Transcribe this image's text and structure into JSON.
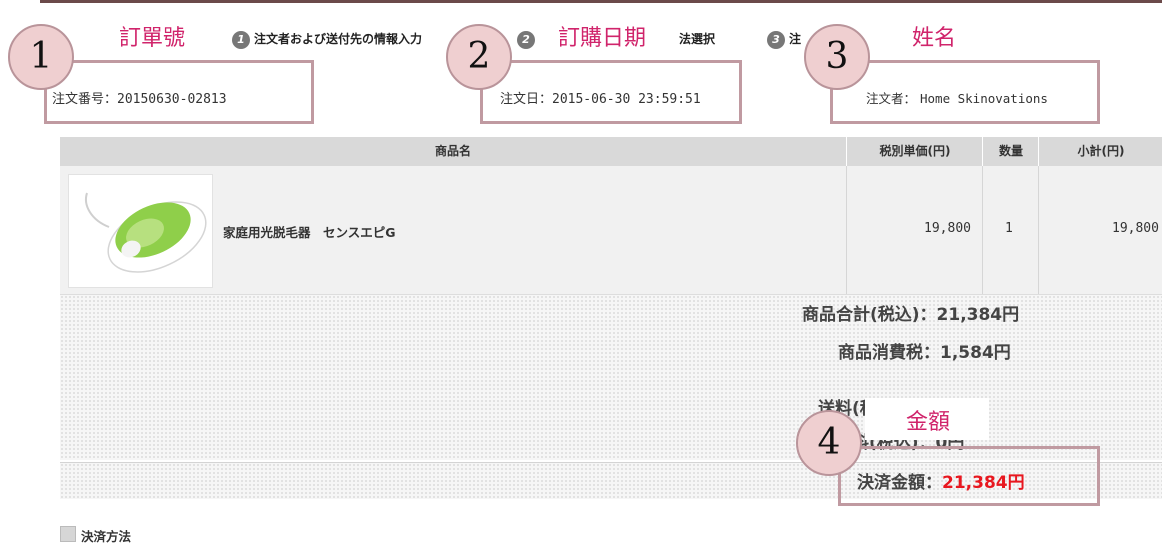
{
  "steps": [
    {
      "num": "1",
      "label": "注文者および送付先の情報入力"
    },
    {
      "num": "2",
      "label": "法選択"
    },
    {
      "num": "3",
      "label": "注"
    }
  ],
  "annotations": [
    {
      "num": "1",
      "label": "訂單號"
    },
    {
      "num": "2",
      "label": "訂購日期"
    },
    {
      "num": "3",
      "label": "姓名"
    },
    {
      "num": "4",
      "label": "金額"
    }
  ],
  "order": {
    "number_label": "注文番号：20150630-02813",
    "date_label": "注文日：2015-06-30 23:59:51",
    "customer_label": "注文者：",
    "customer_name": "Home Skinovations"
  },
  "table": {
    "headers": [
      "商品名",
      "税別単価(円)",
      "数量",
      "小計(円)"
    ],
    "rows": [
      {
        "name": "家庭用光脱毛器　センスエピG",
        "unit_price": "19,800",
        "qty": "1",
        "subtotal": "19,800"
      }
    ]
  },
  "summary": {
    "goods_total": "商品合計(税込)：21,384円",
    "tax": "商品消費税：1,584円",
    "shipping_partial": "送料(税込)：0円",
    "fee_partial": "手数料(税込)：0円",
    "payment_label": "決済金額：",
    "payment_value": "21,384円"
  },
  "section": {
    "payment_method": "決済方法"
  },
  "colors": {
    "annotation_pink": "#d0246b",
    "annotation_circle": "#efcfd0",
    "annotation_border": "#c09aa1",
    "amount_red": "#e8171f"
  }
}
